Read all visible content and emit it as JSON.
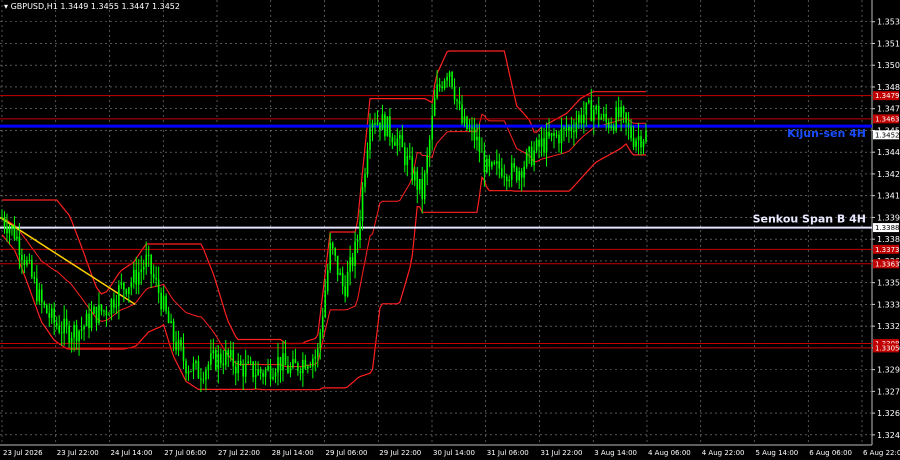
{
  "header": {
    "symbol": "GBPUSD,H1",
    "ohlc": "1.3449 1.3455 1.3447 1.3452"
  },
  "colors": {
    "background": "#000000",
    "grid": "#8a8a8a",
    "candle": "#00ff00",
    "band": "#ff2020",
    "level": "#c80000",
    "kijun": "#0000ff",
    "senkou": "#e6e6ff",
    "trend": "#ffd000"
  },
  "chart_data": {
    "type": "candlestick",
    "title": "GBPUSD,H1",
    "grid": true,
    "ylim": [
      1.3238,
      1.3545
    ],
    "y_ticks": [
      "1.3530",
      "1.3515",
      "1.3500",
      "1.3485",
      "1.3470",
      "1.3455",
      "1.3440",
      "1.3425",
      "1.3410",
      "1.3395",
      "1.3380",
      "1.3365",
      "1.3350",
      "1.3335",
      "1.3320",
      "1.3305",
      "1.3290",
      "1.3275",
      "1.3260",
      "1.3245"
    ],
    "x_tick_labels": [
      "23 Jul 2026",
      "23 Jul 22:00",
      "24 Jul 14:00",
      "27 Jul 06:00",
      "27 Jul 22:00",
      "28 Jul 14:00",
      "29 Jul 06:00",
      "29 Jul 22:00",
      "30 Jul 14:00",
      "31 Jul 06:00",
      "31 Jul 22:00",
      "3 Aug 14:00",
      "4 Aug 06:00",
      "4 Aug 22:00",
      "5 Aug 14:00",
      "6 Aug 06:00",
      "6 Aug 22:00"
    ],
    "price_path": [
      1.3395,
      1.3384,
      1.336,
      1.3335,
      1.3322,
      1.3316,
      1.3318,
      1.3328,
      1.3332,
      1.3346,
      1.3352,
      1.3365,
      1.3342,
      1.3312,
      1.3294,
      1.3288,
      1.3296,
      1.3299,
      1.3292,
      1.3289,
      1.3288,
      1.3296,
      1.3289,
      1.3297,
      1.33,
      1.3375,
      1.3345,
      1.3376,
      1.3465,
      1.346,
      1.345,
      1.343,
      1.341,
      1.348,
      1.35,
      1.346,
      1.345,
      1.3425,
      1.343,
      1.3425,
      1.3435,
      1.3445,
      1.345,
      1.3455,
      1.3465,
      1.347,
      1.346,
      1.3465,
      1.345,
      1.3452
    ],
    "levels": [
      {
        "label": "1.3479",
        "value": 1.3479,
        "kind": "resistance"
      },
      {
        "label": "1.3463",
        "value": 1.3463,
        "kind": "resistance"
      },
      {
        "label": "1.3452",
        "value": 1.3452,
        "kind": "current"
      },
      {
        "label": "1.3388",
        "value": 1.3388,
        "kind": "senkou"
      },
      {
        "label": "1.3373",
        "value": 1.3373,
        "kind": "support"
      },
      {
        "label": "1.3363",
        "value": 1.3363,
        "kind": "support"
      },
      {
        "label": "1.3308",
        "value": 1.3308,
        "kind": "support"
      },
      {
        "label": "1.3305",
        "value": 1.3305,
        "kind": "support"
      }
    ],
    "kijun_value": 1.3458,
    "annotations": [
      {
        "text": "Kijun-sen 4H",
        "value": 1.3452
      },
      {
        "text": "Senkou Span B 4H",
        "value": 1.3393
      }
    ],
    "trendline": [
      [
        0,
        1.3395
      ],
      [
        0.155,
        1.3335
      ]
    ]
  }
}
